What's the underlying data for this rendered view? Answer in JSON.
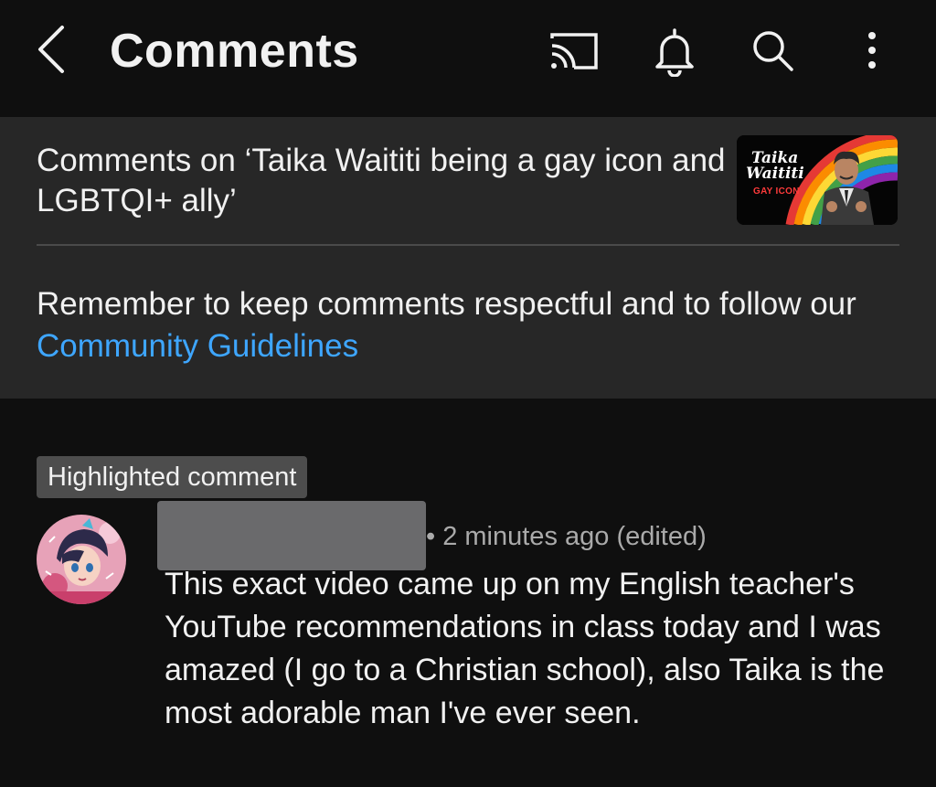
{
  "topbar": {
    "title": "Comments",
    "icons": [
      "back-chevron-icon",
      "cast-icon",
      "bell-icon",
      "search-icon",
      "more-vertical-icon"
    ]
  },
  "header": {
    "video_title": "Comments on ‘Taika Waititi being a gay icon and LGBTQI+ ally’",
    "thumbnail": {
      "line1": "Taika",
      "line2": "Waititi",
      "line3": "GAY ICON"
    },
    "guidelines_text": "Remember to keep comments respectful and to follow our ",
    "guidelines_link": "Community Guidelines"
  },
  "comment": {
    "badge": "Highlighted comment",
    "meta": "• 2 minutes ago (edited)",
    "text": "This exact video came up on my English teacher's YouTube recommendations in class today and I was amazed (I go to a Christian school), also Taika is the most adorable man I've ever seen."
  },
  "colors": {
    "background": "#0f0f0f",
    "panel": "#272727",
    "link": "#3ea6ff",
    "secondary_text": "#aaaaaa"
  }
}
